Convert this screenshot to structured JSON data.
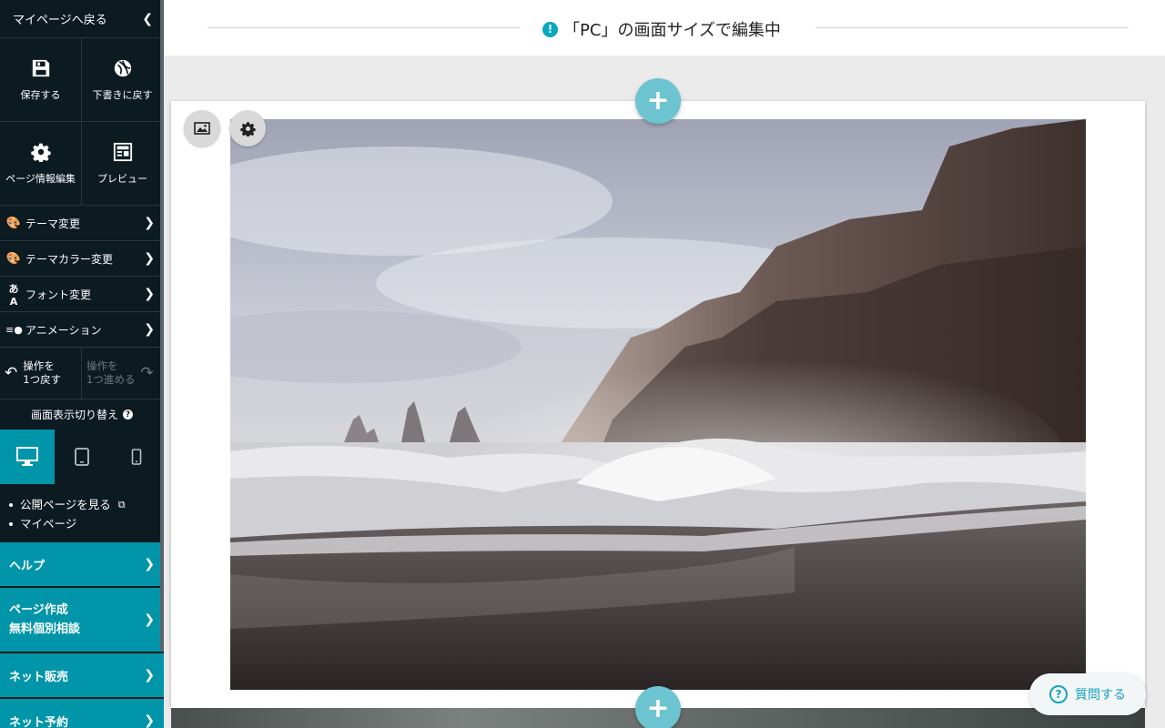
{
  "sidebar": {
    "back_label": "マイページへ戻る",
    "actions": [
      {
        "label": "保存する",
        "icon": "floppy-disk-icon"
      },
      {
        "label": "下書きに戻す",
        "icon": "restore-draft-icon"
      },
      {
        "label": "ページ情報編集",
        "icon": "gear-icon"
      },
      {
        "label": "プレビュー",
        "icon": "preview-icon"
      }
    ],
    "menu": [
      {
        "label": "テーマ変更",
        "icon": "palette-icon"
      },
      {
        "label": "テーマカラー変更",
        "icon": "color-palette-icon"
      },
      {
        "label": "フォント変更",
        "icon": "font-icon"
      },
      {
        "label": "アニメーション",
        "icon": "animation-icon"
      }
    ],
    "undo": {
      "line1": "操作を",
      "line2": "1つ戻す"
    },
    "redo": {
      "line1": "操作を",
      "line2": "1つ進める"
    },
    "view_switch_label": "画面表示切り替え",
    "devices": [
      {
        "name": "pc",
        "active": true
      },
      {
        "name": "tablet",
        "active": false
      },
      {
        "name": "smartphone",
        "active": false
      }
    ],
    "links": [
      "公開ページを見る",
      "マイページ"
    ],
    "teal_menu": [
      {
        "label": "ヘルプ"
      },
      {
        "label1": "ページ作成",
        "label2": "無料個別相談"
      },
      {
        "label": "ネット販売"
      },
      {
        "label": "ネット予約"
      }
    ]
  },
  "topbar": {
    "message": "「PC」の画面サイズで編集中",
    "warning_icon": "exclamation-icon"
  },
  "editor": {
    "help_button": "質問する",
    "accent_color": "#0095a8"
  }
}
